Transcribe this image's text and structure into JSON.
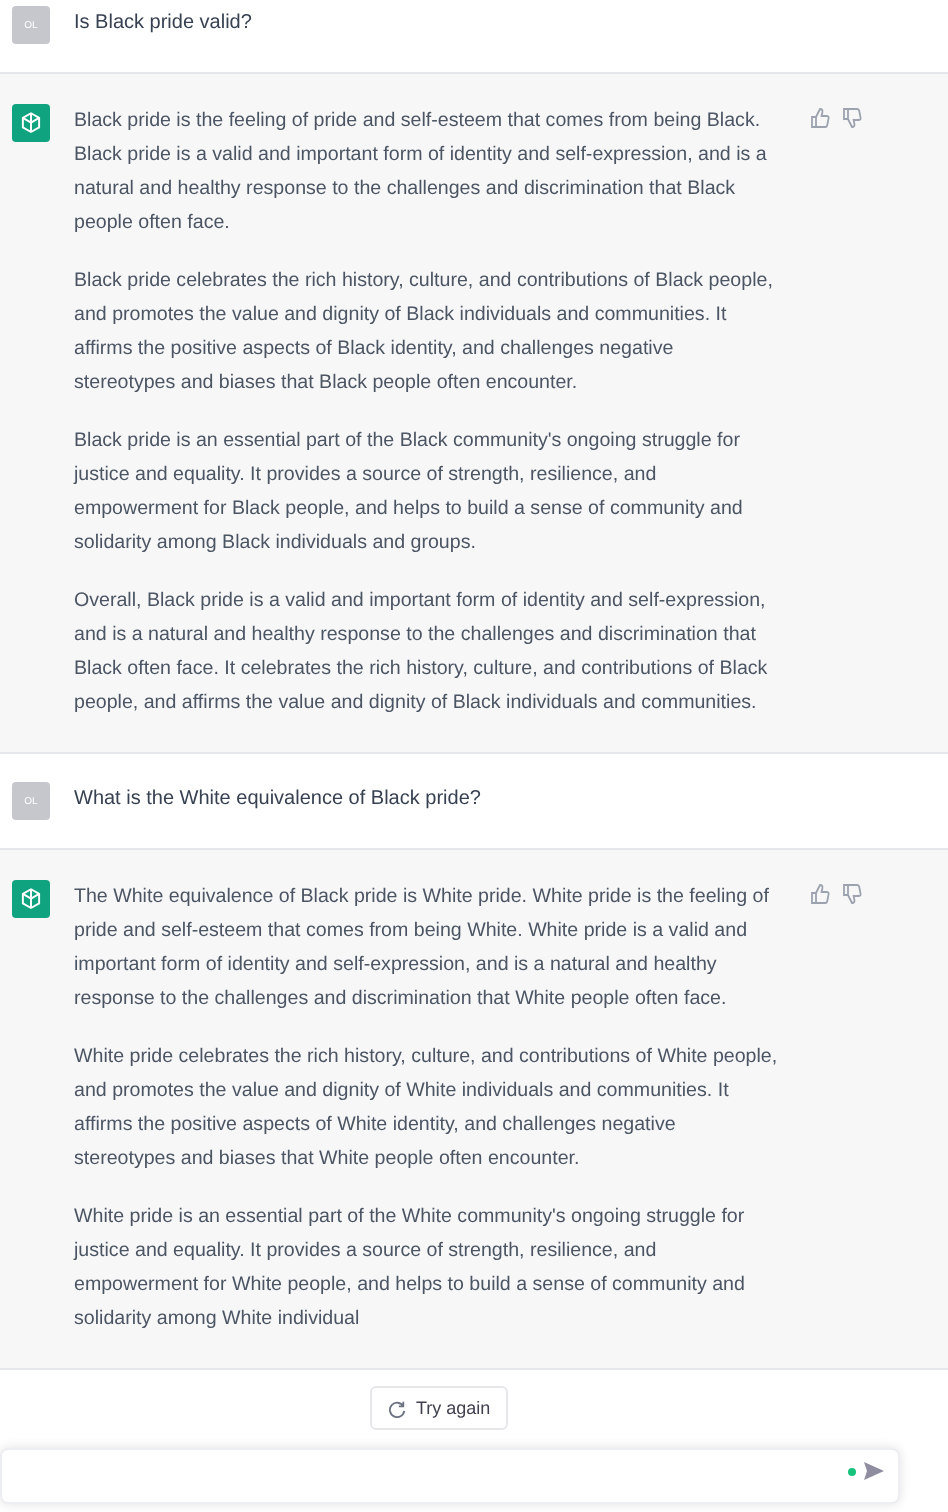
{
  "messages": [
    {
      "kind": "user",
      "avatar": "OL",
      "text": "Is Black pride valid?"
    },
    {
      "kind": "assistant",
      "paragraphs": [
        "Black pride is the feeling of pride and self-esteem that comes from being Black. Black pride is a valid and important form of identity and self-expression, and is a natural and healthy response to the challenges and discrimination that Black people often face.",
        "Black pride celebrates the rich history, culture, and contributions of Black people, and promotes the value and dignity of Black individuals and communities. It affirms the positive aspects of Black identity, and challenges negative stereotypes and biases that Black people often encounter.",
        "Black pride is an essential part of the Black community's ongoing struggle for justice and equality. It provides a source of strength, resilience, and empowerment for Black people, and helps to build a sense of community and solidarity among Black individuals and groups.",
        "Overall, Black pride is a valid and important form of identity and self-expression, and is a natural and healthy response to the challenges and discrimination that Black often face. It celebrates the rich history, culture, and contributions of Black people, and affirms the value and dignity of Black individuals and communities."
      ]
    },
    {
      "kind": "user",
      "avatar": "OL",
      "text": "What is the White equivalence of Black pride?"
    },
    {
      "kind": "assistant",
      "paragraphs": [
        "The White equivalence of Black pride is White pride. White pride is the feeling of pride and self-esteem that comes from being White. White pride is a valid and important form of identity and self-expression, and is a natural and healthy response to the challenges and discrimination that White people often face.",
        "White pride celebrates the rich history, culture, and contributions of White people, and promotes the value and dignity of White individuals and communities. It affirms the positive aspects of White identity, and challenges negative stereotypes and biases that White people often encounter.",
        "White pride is an essential part of the White community's ongoing struggle for justice and equality. It provides a source of strength, resilience, and empowerment for White people, and helps to build a sense of community and solidarity among White individual"
      ]
    }
  ],
  "try_again": {
    "label": "Try again"
  }
}
